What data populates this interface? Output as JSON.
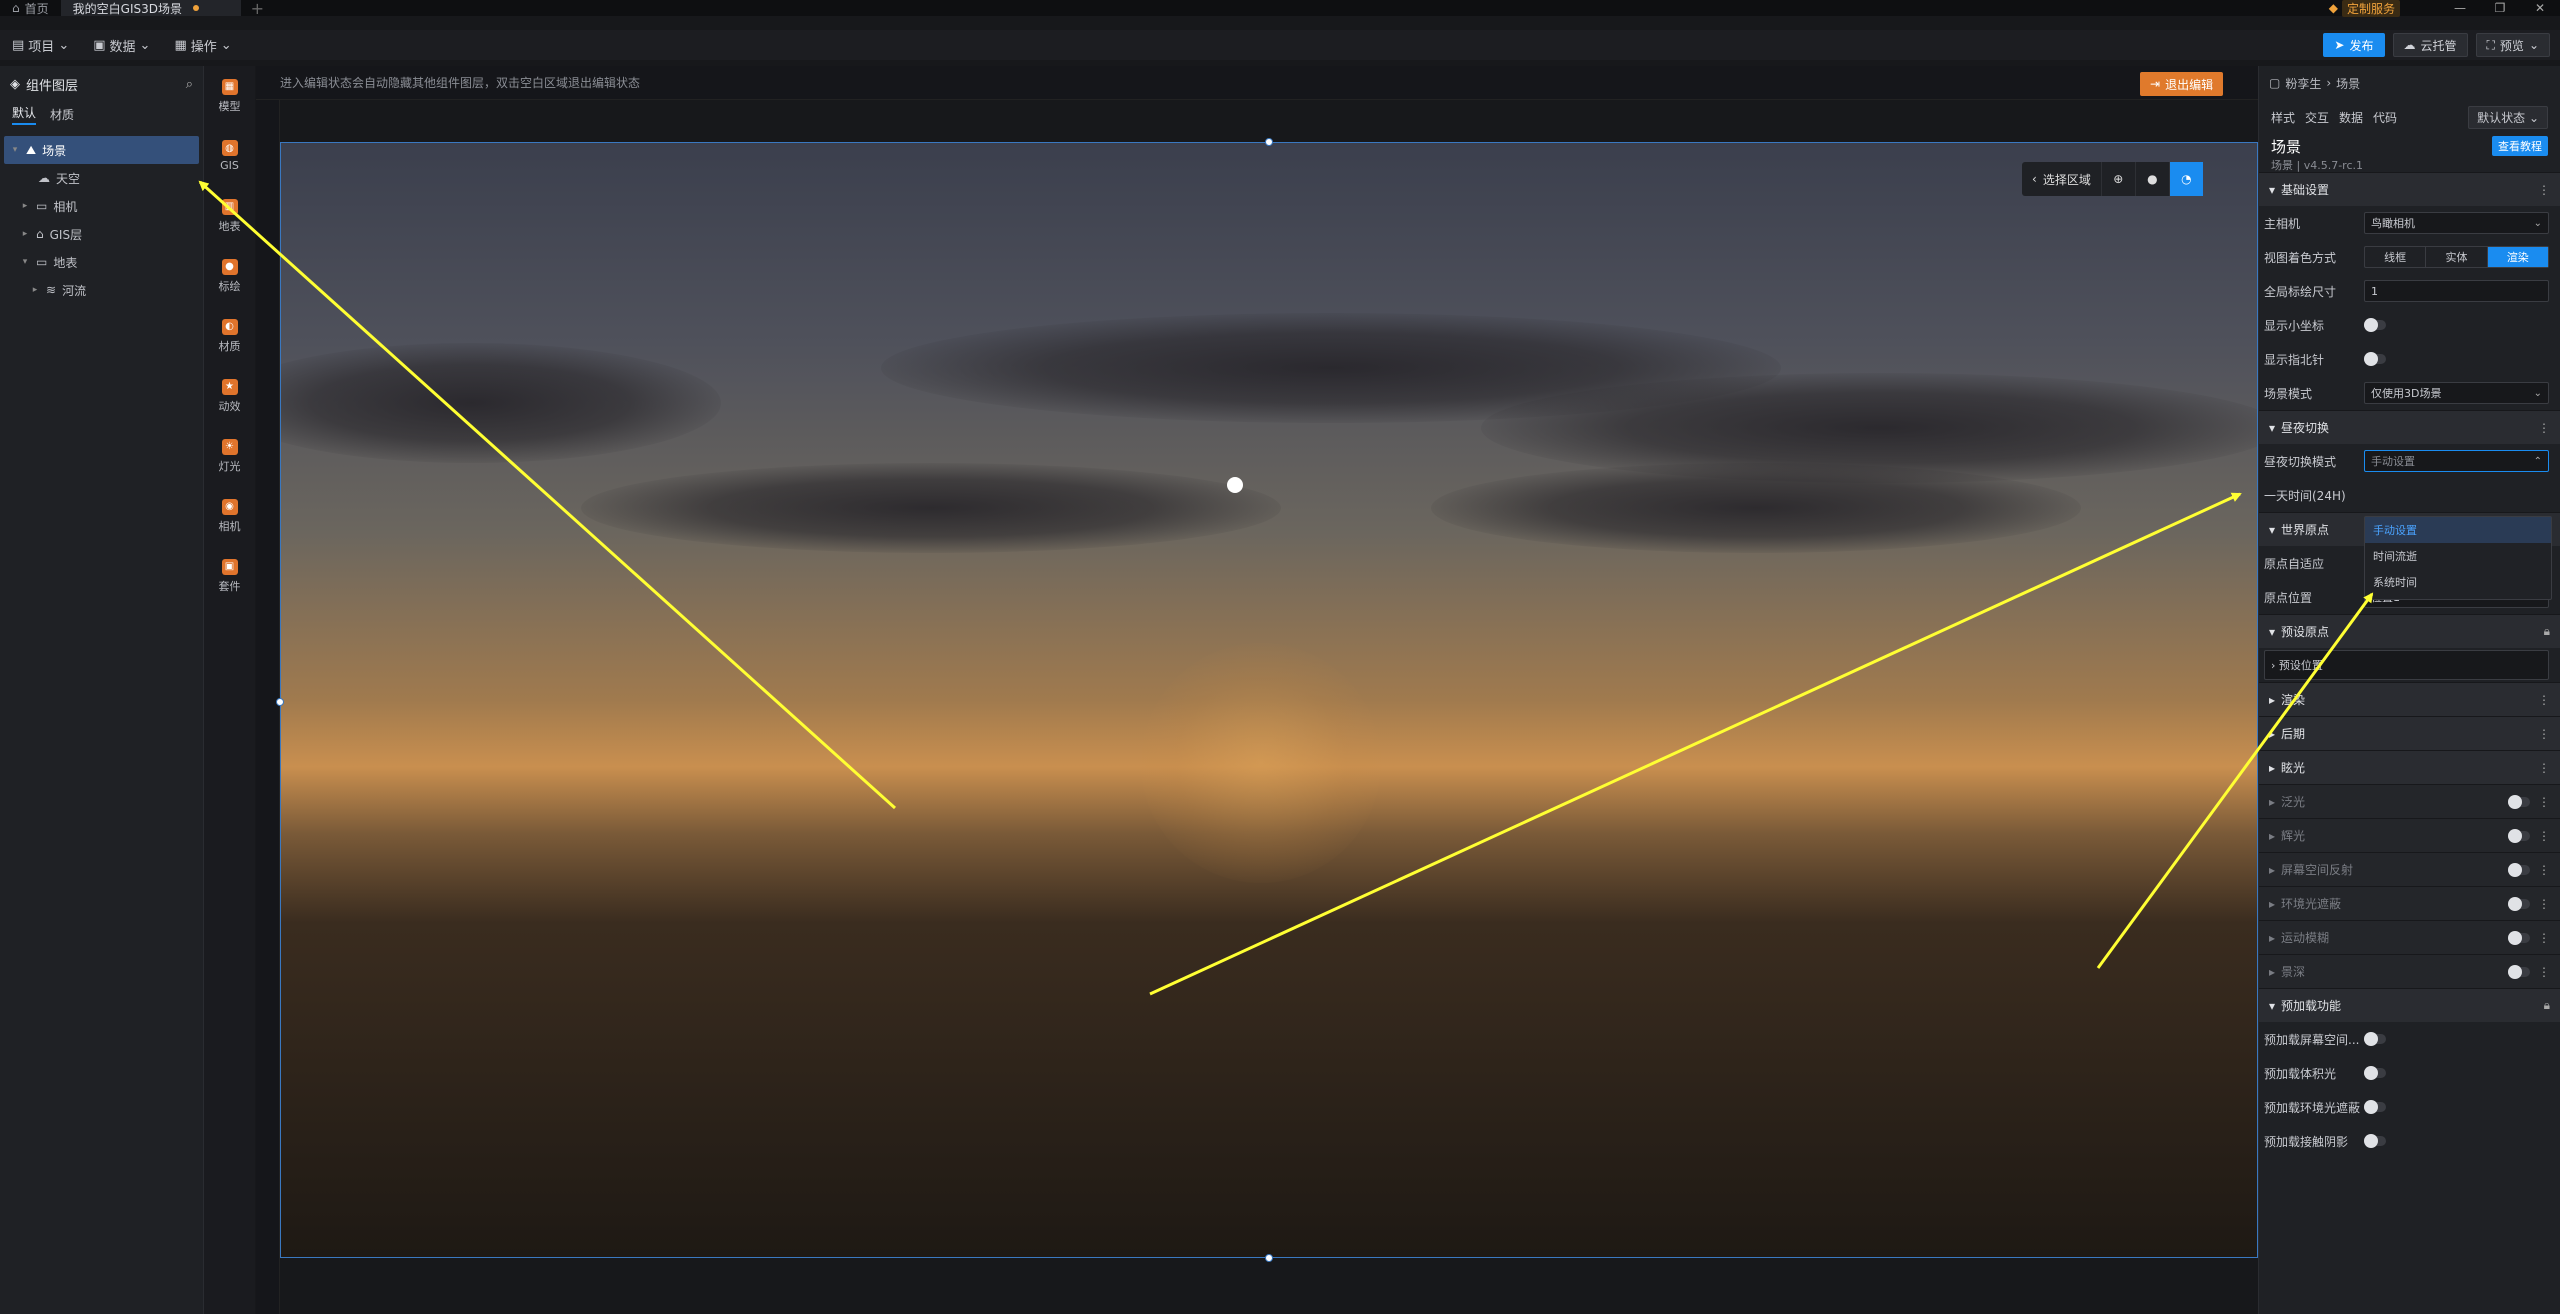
{
  "tabs": [
    {
      "label": "首页"
    },
    {
      "label": "我的空白GIS3D场景"
    }
  ],
  "custom_service": "定制服务",
  "toolbar": {
    "project": "项目",
    "data": "数据",
    "ops": "操作",
    "publish": "发布",
    "cloud": "云托管",
    "preview": "预览"
  },
  "layer_panel": {
    "title": "组件图层",
    "tabs": [
      "默认",
      "材质"
    ],
    "tree": [
      {
        "label": "场景",
        "icon": "scene-icon"
      },
      {
        "label": "天空",
        "icon": "sky-icon"
      },
      {
        "label": "相机",
        "icon": "folder-icon"
      },
      {
        "label": "GIS层",
        "icon": "gis-layer-icon"
      },
      {
        "label": "地表",
        "icon": "folder-icon"
      },
      {
        "label": "河流",
        "icon": "river-icon"
      }
    ]
  },
  "components": [
    "模型",
    "GIS",
    "地表",
    "标绘",
    "材质",
    "动效",
    "灯光",
    "相机",
    "套件"
  ],
  "canvas": {
    "hint": "进入编辑状态会自动隐藏其他组件图层，双击空白区域退出编辑状态",
    "exit_edit": "退出编辑",
    "select_area": "选择区域"
  },
  "right_panel": {
    "breadcrumb": [
      "粉孪生",
      "场景"
    ],
    "tabs": [
      "样式",
      "交互",
      "数据",
      "代码"
    ],
    "state": "默认状态",
    "title": "场景",
    "version": "场景 | v4.5.7-rc.1",
    "tutorial": "查看教程",
    "sections": {
      "basic": "基础设置",
      "daynight": "昼夜切换",
      "origin": "世界原点",
      "preset": "预设原点",
      "render": "渲染",
      "post": "后期",
      "glow": "眩光",
      "preload": "预加载功能"
    },
    "basic_rows": {
      "main_camera": {
        "label": "主相机",
        "value": "鸟瞰相机"
      },
      "shading": {
        "label": "视图着色方式",
        "options": [
          "线框",
          "实体",
          "渲染"
        ]
      },
      "mark_size": {
        "label": "全局标绘尺寸",
        "value": "1"
      },
      "show_axis": {
        "label": "显示小坐标"
      },
      "show_compass": {
        "label": "显示指北针"
      },
      "scene_mode": {
        "label": "场景模式",
        "value": "仅使用3D场景"
      }
    },
    "daynight_rows": {
      "mode": {
        "label": "昼夜切换模式",
        "value": "手动设置"
      },
      "time": {
        "label": "一天时间(24H)"
      }
    },
    "dropdown_options": [
      "手动设置",
      "时间流逝",
      "系统时间"
    ],
    "origin_rows": {
      "adaptive": {
        "label": "原点自适应"
      },
      "position": {
        "label": "原点位置",
        "value": "位置1"
      }
    },
    "preset_item": "预设位置",
    "glow_items": [
      "泛光",
      "辉光",
      "屏幕空间反射",
      "环境光遮蔽",
      "运动模糊",
      "景深"
    ],
    "preload_items": [
      "预加载屏幕空间...",
      "预加载体积光",
      "预加载环境光遮蔽",
      "预加载接触阴影"
    ]
  },
  "colors": {
    "accent": "#1a8cf0",
    "exit_edit": "#e07a2c",
    "annotation": "#ffff33"
  }
}
